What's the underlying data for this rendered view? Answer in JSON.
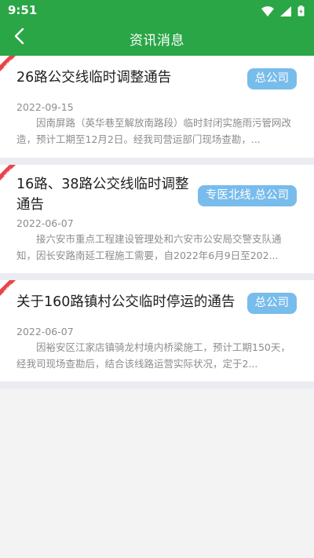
{
  "status_bar": {
    "time": "9:51"
  },
  "header": {
    "title": "资讯消息",
    "colors": {
      "background": "#2aa646"
    }
  },
  "news": [
    {
      "title": "26路公交线临时调整通告",
      "tag": "总公司",
      "date": "2022-09-15",
      "summary": "因南屏路（英华巷至解放南路段）临时封闭实施雨污管网改造，预计工期至12月2日。经我司营运部门现场查勘，..."
    },
    {
      "title_line1": "16路、38路公交线临时调整",
      "title_line2": "通告",
      "tag": "专医北线,总公司",
      "date": "2022-06-07",
      "summary": "接六安市重点工程建设管理处和六安市公安局交警支队通知，因长安路南延工程施工需要，自2022年6月9日至202..."
    },
    {
      "title": "关于160路镇村公交临时停运的通告",
      "tag": "总公司",
      "date": "2022-06-07",
      "summary": "因裕安区江家店镇骑龙村境内桥梁施工，预计工期150天，经我司现场查勘后，结合该线路运营实际状况，定于2..."
    }
  ],
  "icons": [
    "wifi-icon",
    "signal-icon",
    "battery-icon",
    "back-arrow-icon",
    "new-ribbon-icon"
  ],
  "colors": {
    "tag_bg": "#78bcec",
    "divider": "#ebebf2",
    "new_ribbon": "#e8454b"
  }
}
